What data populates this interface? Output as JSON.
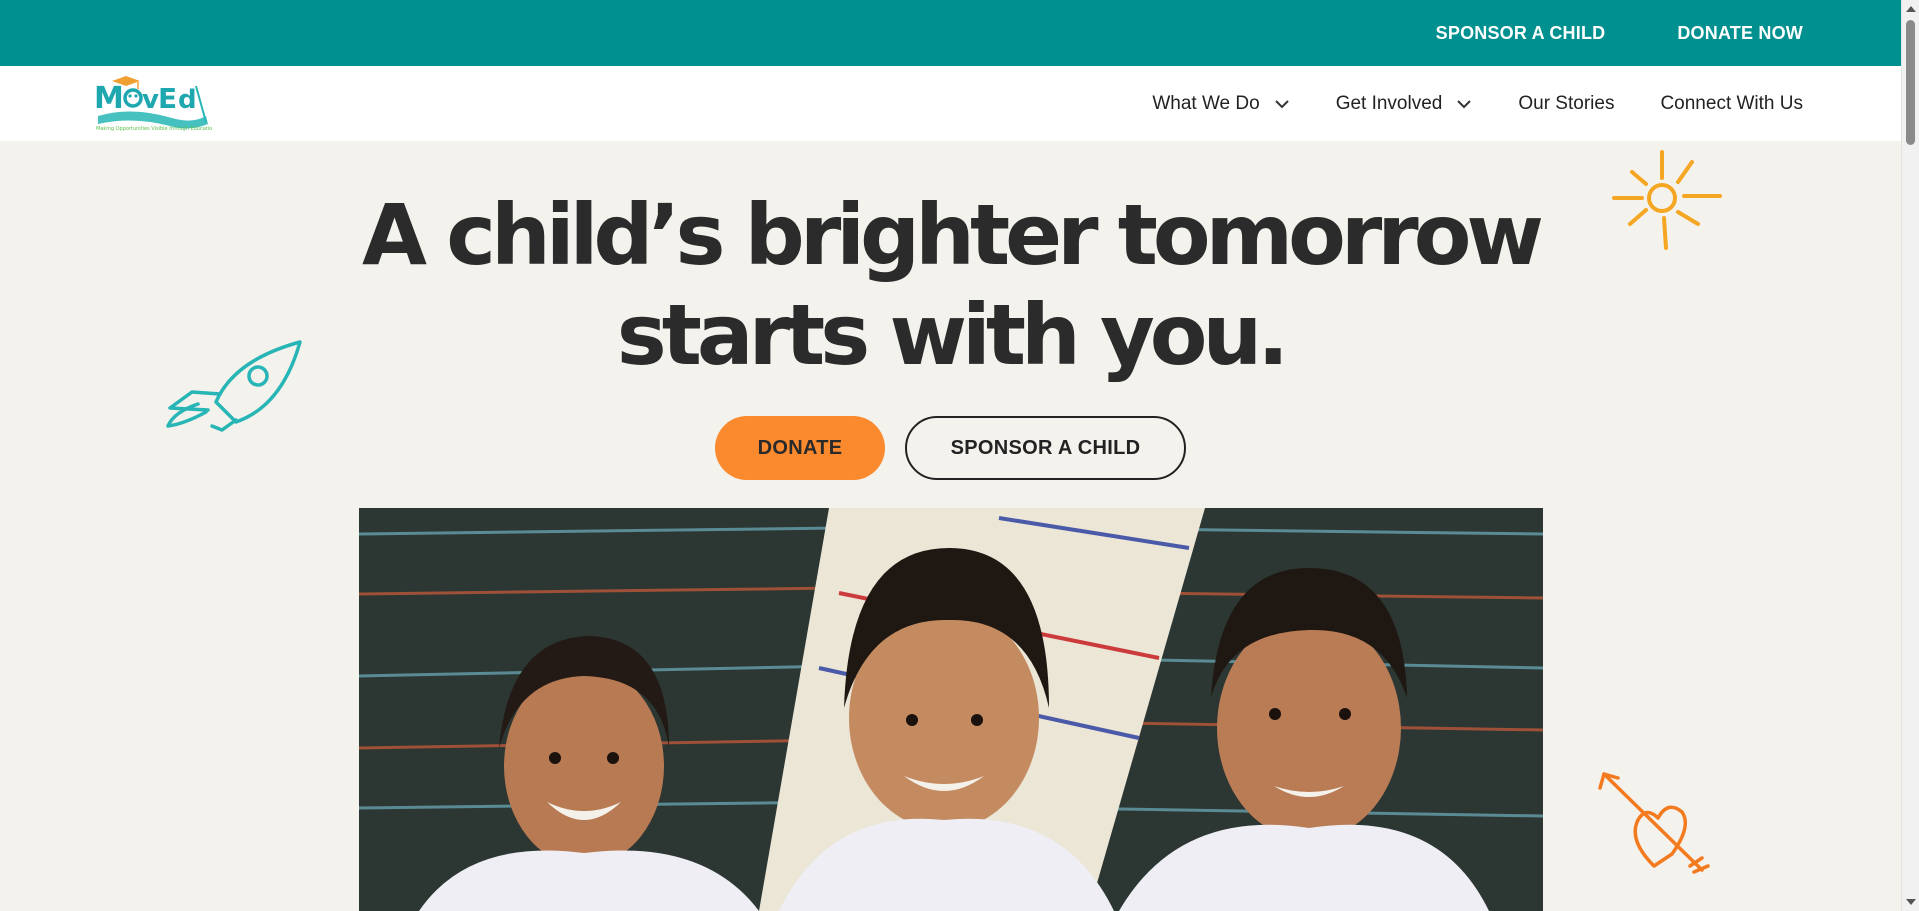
{
  "topbar": {
    "sponsor_label": "SPONSOR A CHILD",
    "donate_label": "DONATE NOW",
    "bg_color": "#009090"
  },
  "logo": {
    "text": "MovEd",
    "tagline": "Making Opportunities Visible through Education"
  },
  "nav": {
    "items": [
      {
        "label": "What We Do",
        "has_dropdown": true
      },
      {
        "label": "Get Involved",
        "has_dropdown": true
      },
      {
        "label": "Our Stories",
        "has_dropdown": false
      },
      {
        "label": "Connect With Us",
        "has_dropdown": false
      }
    ]
  },
  "hero": {
    "title_line1": "A child’s brighter tomorrow",
    "title_line2": "starts with you.",
    "donate_label": "DONATE",
    "sponsor_label": "SPONSOR A CHILD",
    "donate_color": "#fb8a2e"
  },
  "doodles": {
    "sun_color": "#f5a623",
    "rocket_color": "#27b5b5",
    "heart_color": "#f47a20"
  }
}
